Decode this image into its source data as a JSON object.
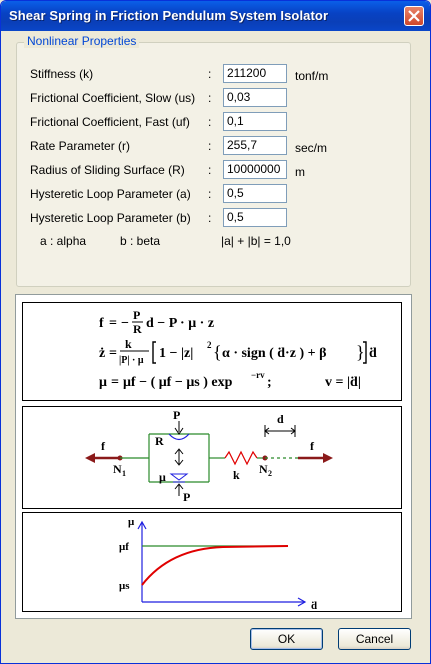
{
  "window": {
    "title": "Shear Spring in Friction Pendulum System Isolator"
  },
  "group": {
    "title": "Nonlinear Properties"
  },
  "properties": [
    {
      "label": "Stiffness (k)",
      "value": "211200",
      "unit": "tonf/m"
    },
    {
      "label": "Frictional Coefficient, Slow (us)",
      "value": "0,03",
      "unit": ""
    },
    {
      "label": "Frictional Coefficient, Fast (uf)",
      "value": "0,1",
      "unit": ""
    },
    {
      "label": "Rate Parameter (r)",
      "value": "255,7",
      "unit": "sec/m"
    },
    {
      "label": "Radius of Sliding Surface (R)",
      "value": "10000000",
      "unit": "m"
    },
    {
      "label": "Hysteretic Loop Parameter (a)",
      "value": "0,5",
      "unit": ""
    },
    {
      "label": "Hysteretic Loop Parameter (b)",
      "value": "0,5",
      "unit": ""
    }
  ],
  "notes": {
    "alpha": "a : alpha",
    "beta": "b : beta",
    "constraint": "|a| + |b| = 1,0"
  },
  "equations": {
    "eq1_lhs": "f",
    "eq1_minus": "−",
    "eq1_P": "P",
    "eq1_R": "R",
    "eq1_rest": "d − P · μ · z",
    "eq2_lhs": "ż",
    "eq2_k": "k",
    "eq2_den": "|P| · μ",
    "eq2_body": "1 − |z|",
    "eq2_exp": "2",
    "eq2_inner": "α · sign ( ḋ·z ) + β",
    "eq2_tail": "ḋ",
    "eq3_lhs": "μ",
    "eq3_body": "μf − ( μf − μs ) exp",
    "eq3_exp": "−rv",
    "eq3_semicolon": ";",
    "eq3_v": "v = |ḋ|"
  },
  "diagram": {
    "f_left": "f",
    "f_right": "f",
    "P_top": "P",
    "P_bottom": "P",
    "R": "R",
    "mu": "μ",
    "k": "k",
    "N1": "N",
    "N1_sub": "1",
    "N2": "N",
    "N2_sub": "2",
    "d": "d"
  },
  "graph": {
    "y_axis": "μ",
    "mu_f": "μf",
    "mu_s": "μs",
    "x_axis": "ḋ",
    "colors": {
      "axis": "#1f1fe0",
      "curve": "#e00000",
      "line": "#2a8a2a"
    }
  },
  "buttons": {
    "ok": "OK",
    "cancel": "Cancel"
  }
}
